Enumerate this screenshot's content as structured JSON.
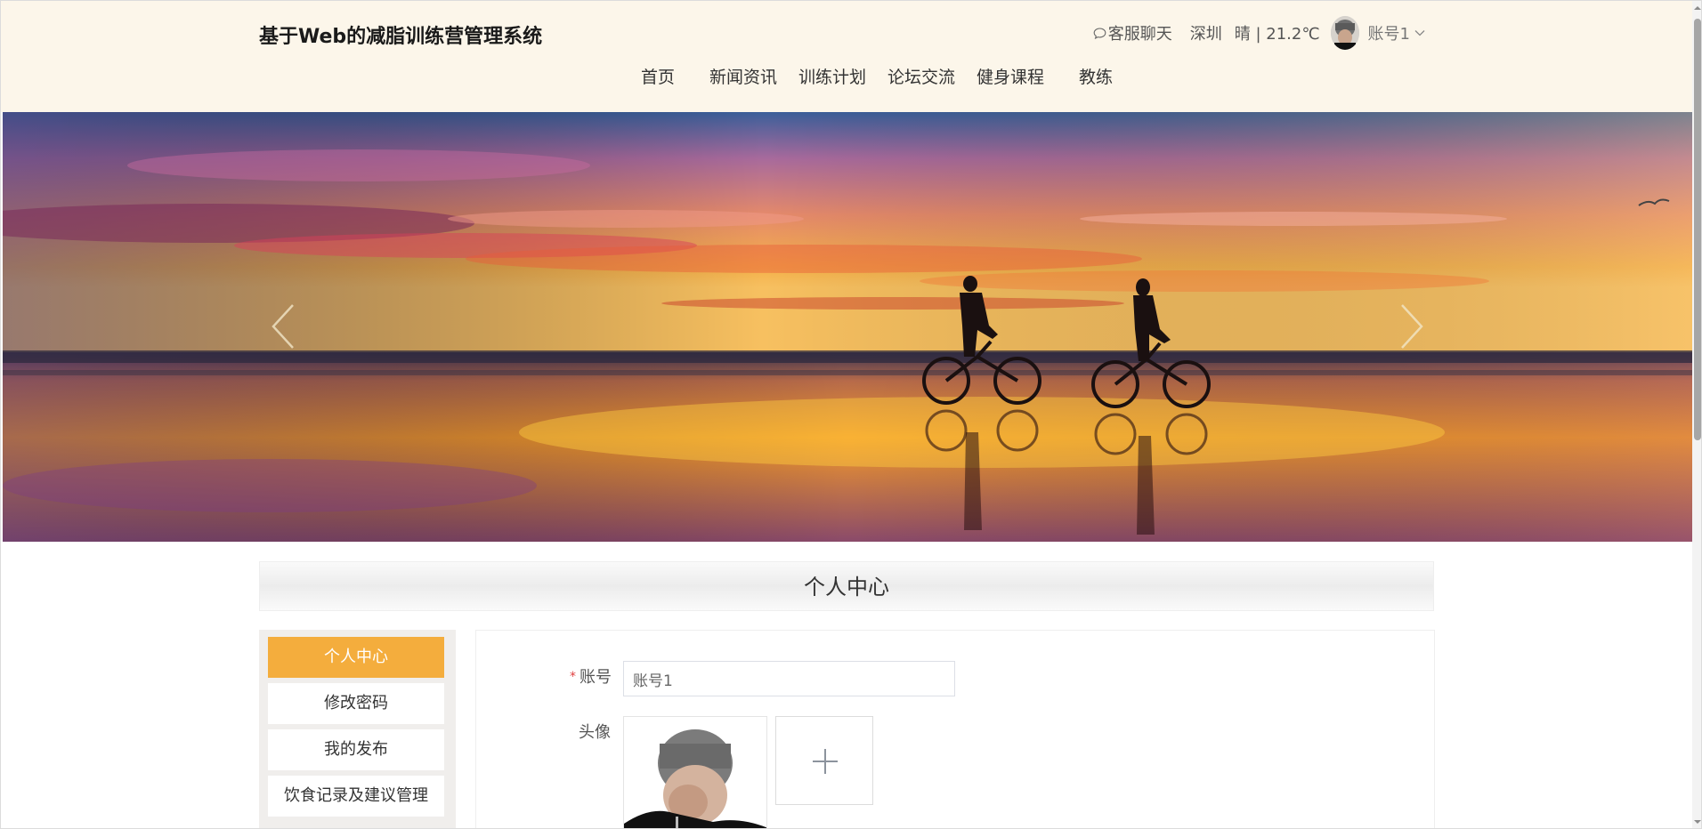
{
  "header": {
    "site_title": "基于Web的减脂训练营管理系统",
    "chat_label": "客服聊天",
    "weather_city": "深圳",
    "weather_info": "晴 | 21.2℃",
    "username": "账号1"
  },
  "nav": {
    "items": [
      "首页",
      "新闻资讯",
      "训练计划",
      "论坛交流",
      "健身课程",
      "教练"
    ]
  },
  "page": {
    "section_title": "个人中心"
  },
  "side_menu": {
    "items": [
      "个人中心",
      "修改密码",
      "我的发布",
      "饮食记录及建议管理"
    ],
    "active_index": 0
  },
  "form": {
    "account_label": "账号",
    "account_value": "账号1",
    "avatar_label": "头像",
    "required_mark": "*"
  },
  "colors": {
    "header_bg": "#fcf6ea",
    "accent": "#f4ad3d",
    "required": "#e04040"
  },
  "icons": {
    "chat": "chat-bubble-icon",
    "dropdown": "chevron-down-icon",
    "prev": "chevron-left-icon",
    "next": "chevron-right-icon",
    "upload": "plus-icon"
  }
}
